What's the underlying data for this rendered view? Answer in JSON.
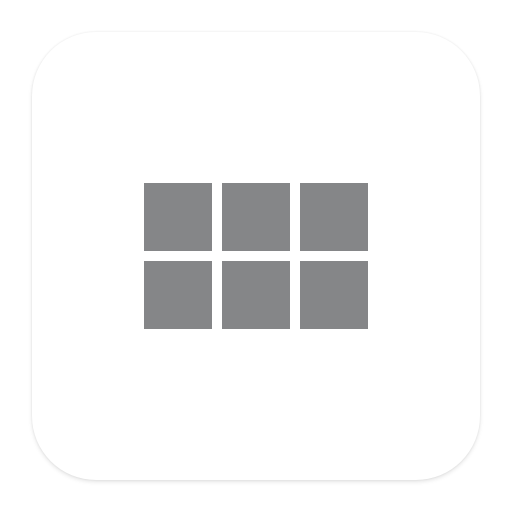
{
  "icon": {
    "name": "grid-view-icon",
    "rows": 2,
    "columns": 3,
    "cell_color": "#858688",
    "tile_background": "#ffffff"
  }
}
